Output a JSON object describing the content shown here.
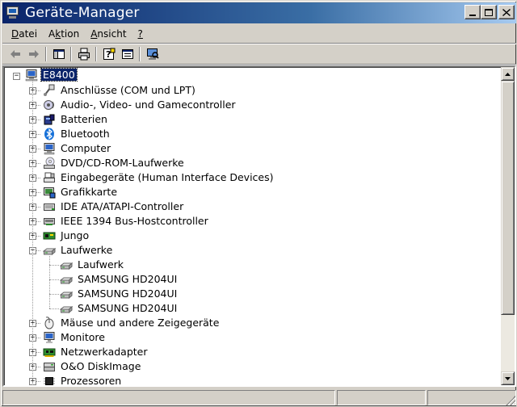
{
  "window": {
    "title": "Geräte-Manager"
  },
  "menu": [
    {
      "label": "Datei",
      "underline": "D"
    },
    {
      "label": "Aktion",
      "underline": "k"
    },
    {
      "label": "Ansicht",
      "underline": "A"
    },
    {
      "label": "?",
      "underline": "?"
    }
  ],
  "toolbar": [
    "back-arrow-icon",
    "forward-arrow-icon",
    "show-hide-console-tree-icon",
    "print-icon",
    "help-icon",
    "properties-icon",
    "scan-hardware-icon"
  ],
  "tree": {
    "root": "E8400",
    "categories": [
      {
        "label": "Anschlüsse (COM und LPT)",
        "icon": "port-icon"
      },
      {
        "label": "Audio-, Video- und Gamecontroller",
        "icon": "speaker-icon"
      },
      {
        "label": "Batterien",
        "icon": "battery-icon"
      },
      {
        "label": "Bluetooth",
        "icon": "bluetooth-icon"
      },
      {
        "label": "Computer",
        "icon": "computer-icon"
      },
      {
        "label": "DVD/CD-ROM-Laufwerke",
        "icon": "cdrom-icon"
      },
      {
        "label": "Eingabegeräte (Human Interface Devices)",
        "icon": "hid-icon"
      },
      {
        "label": "Grafikkarte",
        "icon": "display-adapter-icon"
      },
      {
        "label": "IDE ATA/ATAPI-Controller",
        "icon": "ide-controller-icon"
      },
      {
        "label": "IEEE 1394 Bus-Hostcontroller",
        "icon": "firewire-icon"
      },
      {
        "label": "Jungo",
        "icon": "board-icon"
      },
      {
        "label": "Laufwerke",
        "icon": "disk-drive-icon",
        "expanded": true,
        "children": [
          "Laufwerk",
          "SAMSUNG HD204UI",
          "SAMSUNG HD204UI",
          "SAMSUNG HD204UI"
        ]
      },
      {
        "label": "Mäuse und andere Zeigegeräte",
        "icon": "mouse-icon"
      },
      {
        "label": "Monitore",
        "icon": "monitor-icon"
      },
      {
        "label": "Netzwerkadapter",
        "icon": "network-adapter-icon"
      },
      {
        "label": "O&O DiskImage",
        "icon": "disk-image-icon"
      },
      {
        "label": "Prozessoren",
        "icon": "processor-icon"
      }
    ]
  },
  "colors": {
    "selection": "#0a246a",
    "titlebar_start": "#0a246a",
    "titlebar_end": "#a6caf0"
  }
}
